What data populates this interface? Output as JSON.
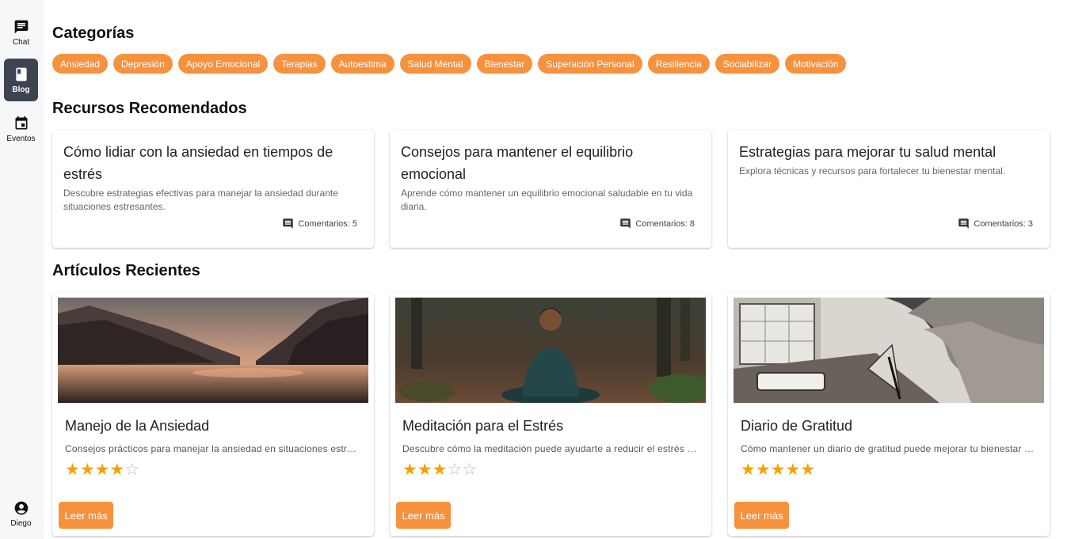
{
  "sidebar": {
    "items": [
      {
        "label": "Chat",
        "icon": "chat-icon"
      },
      {
        "label": "Blog",
        "icon": "book-icon"
      },
      {
        "label": "Eventos",
        "icon": "calendar-icon"
      }
    ],
    "user": {
      "label": "Diego",
      "icon": "account-circle-icon"
    }
  },
  "categories": {
    "title": "Categorías",
    "items": [
      "Ansiedad",
      "Depresión",
      "Apoyo Emocional",
      "Terapias",
      "Autoestima",
      "Salud Mental",
      "Bienestar",
      "Superación Personal",
      "Resiliencia",
      "Sociabilizar",
      "Motivación"
    ]
  },
  "resources": {
    "title": "Recursos Recomendados",
    "items": [
      {
        "title": "Cómo lidiar con la ansiedad en tiempos de estrés",
        "description": "Descubre estrategias efectivas para manejar la ansiedad durante situaciones estresantes.",
        "comments": "Comentarios: 5"
      },
      {
        "title": "Consejos para mantener el equilibrio emocional",
        "description": "Aprende cómo mantener un equilibrio emocional saludable en tu vida diaria.",
        "comments": "Comentarios: 8"
      },
      {
        "title": "Estrategias para mejorar tu salud mental",
        "description": "Explora técnicas y recursos para fortalecer tu bienestar mental.",
        "comments": "Comentarios: 3"
      }
    ]
  },
  "articles": {
    "title": "Artículos Recientes",
    "items": [
      {
        "title": "Manejo de la Ansiedad",
        "description": "Consejos prácticos para manejar la ansiedad en situaciones estresantes.",
        "rating": 4,
        "button": "Leer más"
      },
      {
        "title": "Meditación para el Estrés",
        "description": "Descubre cómo la meditación puede ayudarte a reducir el estrés diario.",
        "rating": 3,
        "button": "Leer más"
      },
      {
        "title": "Diario de Gratitud",
        "description": "Cómo mantener un diario de gratitud puede mejorar tu bienestar emocional.",
        "rating": 5,
        "button": "Leer más"
      }
    ]
  },
  "colors": {
    "accent": "#f6913e",
    "sidebar_active": "#3d4451",
    "star": "#f5a201"
  }
}
